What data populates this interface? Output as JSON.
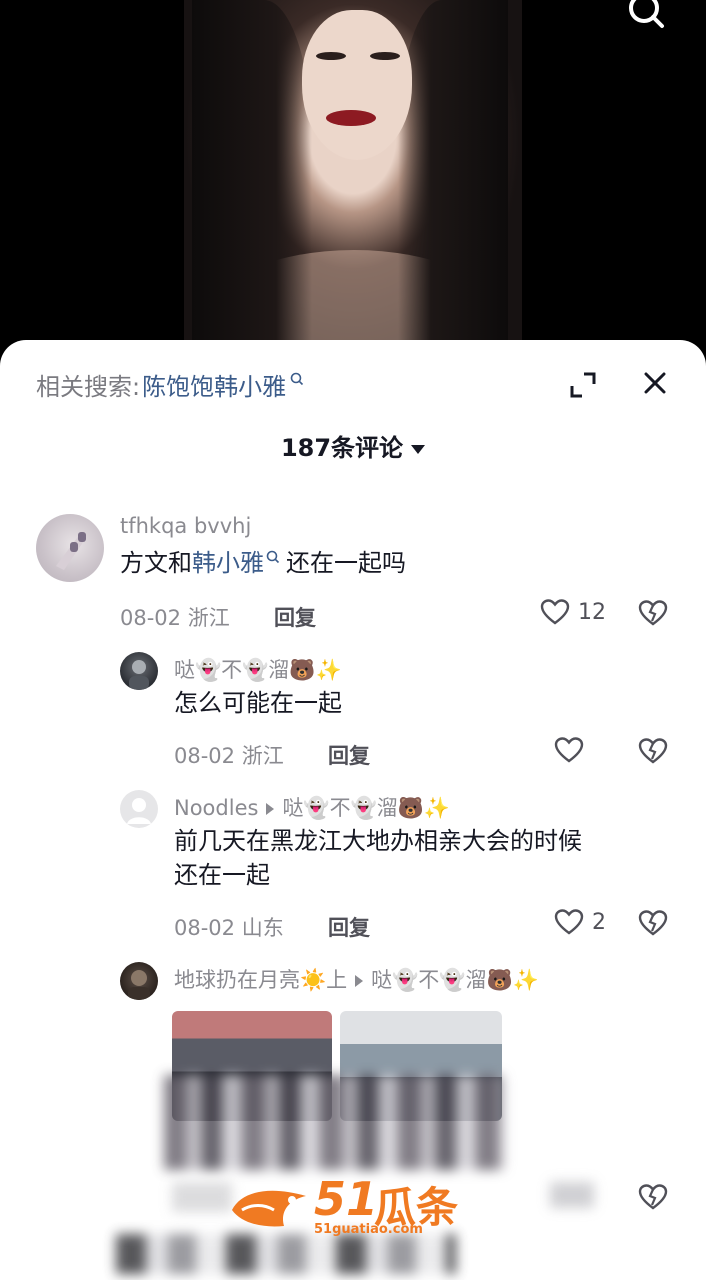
{
  "related_search": {
    "label": "相关搜索:",
    "term": "陈饱饱韩小雅"
  },
  "comment_count": "187条评论",
  "comments": [
    {
      "user": "tfhkqa bvvhj",
      "text_before": "方文和",
      "text_link": "韩小雅",
      "text_after": "还在一起吗",
      "date_loc": "08-02 浙江",
      "reply_label": "回复",
      "likes": "12"
    },
    {
      "user": "哒👻不👻溜🐻✨",
      "text": "怎么可能在一起",
      "date_loc": "08-02 浙江",
      "reply_label": "回复",
      "likes": ""
    },
    {
      "user": "Noodles",
      "reply_to": "哒👻不👻溜🐻✨",
      "text_line1": "前几天在黑龙江大地办相亲大会的时候",
      "text_line2": "还在一起",
      "date_loc": "08-02 山东",
      "reply_label": "回复",
      "likes": "2"
    },
    {
      "user": "地球扔在月亮☀️上",
      "reply_to": "哒👻不👻溜🐻✨"
    }
  ],
  "watermark": {
    "number": "51",
    "chinese": "瓜条",
    "url": "51guatiao.com"
  },
  "icons": {
    "search": "search-icon",
    "expand": "expand-icon",
    "close": "close-icon",
    "like": "heart-icon",
    "dislike": "broken-heart-icon"
  },
  "colors": {
    "link": "#3c5c8a",
    "watermark": "#f07a22"
  }
}
